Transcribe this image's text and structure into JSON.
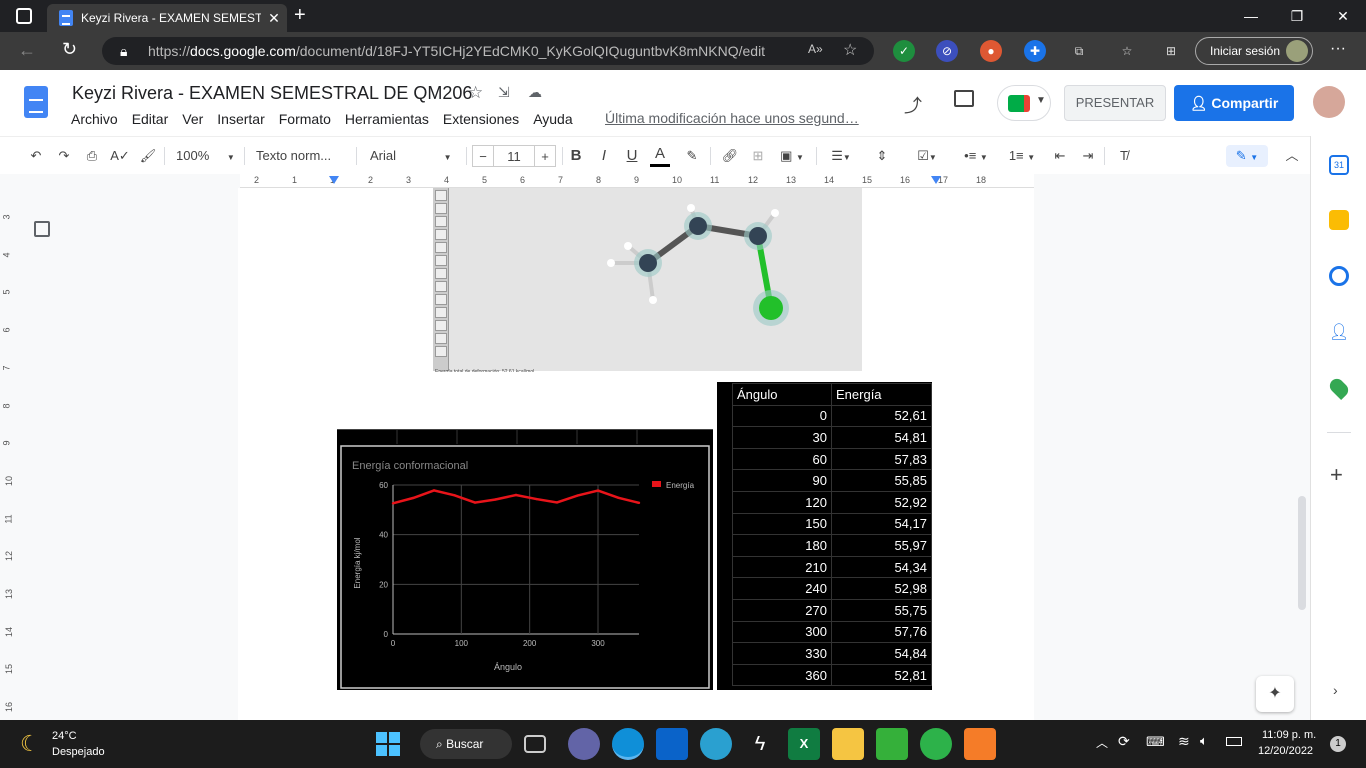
{
  "browser": {
    "tab_title": "Keyzi Rivera - EXAMEN SEMESTR",
    "url_prefix": "https://",
    "url_domain": "docs.google.com",
    "url_path": "/document/d/18FJ-YT5ICHj2YEdCMK0_KyKGolQIQuguntbvK8mNKNQ/edit",
    "signin_label": "Iniciar sesión"
  },
  "docs": {
    "title": "Keyzi Rivera - EXAMEN SEMESTRAL DE QM206",
    "menus": [
      "Archivo",
      "Editar",
      "Ver",
      "Insertar",
      "Formato",
      "Herramientas",
      "Extensiones",
      "Ayuda"
    ],
    "last_modified": "Última modificación hace unos segund…",
    "present_label": "PRESENTAR",
    "share_label": "Compartir"
  },
  "toolbar": {
    "zoom": "100%",
    "style": "Texto norm...",
    "font": "Arial",
    "font_size": "11"
  },
  "ruler": {
    "marks": [
      "2",
      "1",
      "1",
      "2",
      "3",
      "4",
      "5",
      "6",
      "7",
      "8",
      "9",
      "10",
      "11",
      "12",
      "13",
      "14",
      "15",
      "16",
      "17",
      "18"
    ],
    "vmarks": [
      "3",
      "4",
      "5",
      "6",
      "7",
      "8",
      "9",
      "10",
      "11",
      "12",
      "13",
      "14",
      "15",
      "16"
    ]
  },
  "molecule": {
    "caption": "Energía total de deformación: 52.61 kcal/mol"
  },
  "chart_data": {
    "type": "line",
    "title": "Energía conformacional",
    "xlabel": "Ángulo",
    "ylabel": "Energía kj/mol",
    "x": [
      0,
      30,
      60,
      90,
      120,
      150,
      180,
      210,
      240,
      270,
      300,
      330,
      360
    ],
    "series": [
      {
        "name": "Energía",
        "values": [
          52.61,
          54.81,
          57.83,
          55.85,
          52.92,
          54.17,
          55.97,
          54.34,
          52.98,
          55.75,
          57.76,
          54.84,
          52.81
        ],
        "color": "#e8141a"
      }
    ],
    "xlim": [
      0,
      360
    ],
    "ylim": [
      0,
      60
    ],
    "xticks": [
      "0",
      "100",
      "200",
      "300"
    ],
    "yticks": [
      "0",
      "20",
      "40",
      "60"
    ],
    "grid": true,
    "legend": "top-right"
  },
  "table": {
    "headers": [
      "Ángulo",
      "Energía"
    ],
    "rows": [
      [
        "0",
        "52,61"
      ],
      [
        "30",
        "54,81"
      ],
      [
        "60",
        "57,83"
      ],
      [
        "90",
        "55,85"
      ],
      [
        "120",
        "52,92"
      ],
      [
        "150",
        "54,17"
      ],
      [
        "180",
        "55,97"
      ],
      [
        "210",
        "54,34"
      ],
      [
        "240",
        "52,98"
      ],
      [
        "270",
        "55,75"
      ],
      [
        "300",
        "57,76"
      ],
      [
        "330",
        "54,84"
      ],
      [
        "360",
        "52,81"
      ]
    ]
  },
  "taskbar": {
    "weather_temp": "24°C",
    "weather_desc": "Despejado",
    "search_label": "Buscar",
    "time": "11:09 p. m.",
    "date": "12/20/2022",
    "notif_count": "1"
  },
  "colors": {
    "accent": "#1a73e8",
    "chart_line": "#e8141a"
  }
}
